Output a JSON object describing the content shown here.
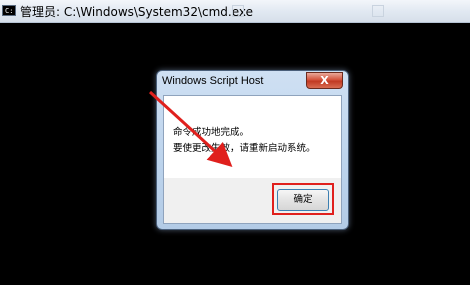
{
  "console": {
    "title": "管理员: C:\\Windows\\System32\\cmd.exe",
    "icon": "console-icon"
  },
  "dialog": {
    "title": "Windows Script Host",
    "close_label": "X",
    "message_lines": [
      "命令成功地完成。",
      "要使更改生效，请重新启动系统。"
    ],
    "ok_label": "确定"
  },
  "annotation": {
    "color": "#e0201d"
  }
}
